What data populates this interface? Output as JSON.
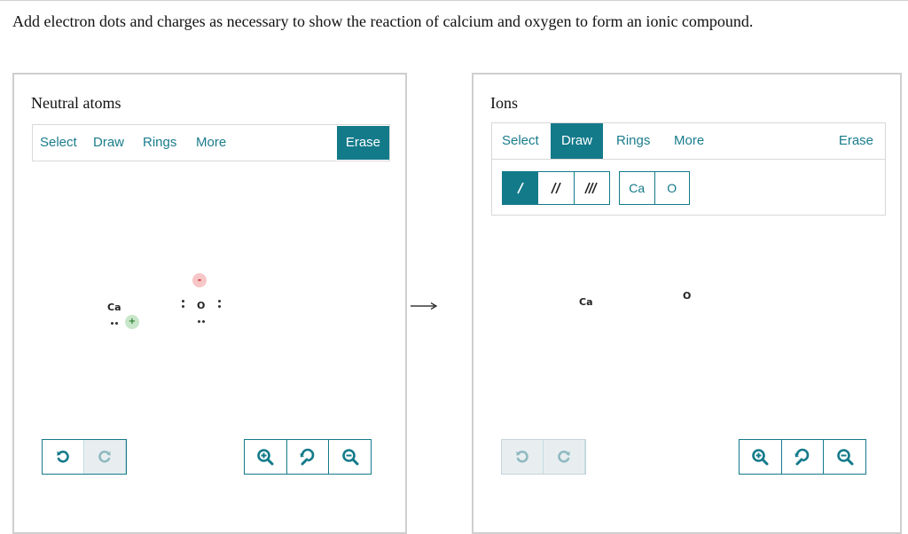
{
  "prompt": "Add electron dots and charges as necessary to show the reaction of calcium and oxygen to form an ionic compound.",
  "left_panel": {
    "title": "Neutral atoms",
    "toolbar": [
      "Select",
      "Draw",
      "Rings",
      "More"
    ],
    "erase_label": "Erase",
    "atoms": {
      "ca": "Ca",
      "o": "O"
    },
    "charges": {
      "plus": "+",
      "minus": "-"
    }
  },
  "right_panel": {
    "title": "Ions",
    "toolbar": [
      "Select",
      "Draw",
      "Rings",
      "More"
    ],
    "active_tool": "Draw",
    "erase_label": "Erase",
    "elements": [
      "Ca",
      "O"
    ],
    "atoms": {
      "ca": "Ca",
      "o": "O"
    }
  },
  "colors": {
    "accent": "#137a8a",
    "plus_bg": "#c8e6c9",
    "minus_bg": "#f7c6c6"
  },
  "icons": [
    "undo-icon",
    "redo-icon",
    "zoom-in-icon",
    "reset-zoom-icon",
    "zoom-out-icon",
    "reaction-arrow-icon",
    "single-bond-icon",
    "double-bond-icon",
    "triple-bond-icon"
  ]
}
